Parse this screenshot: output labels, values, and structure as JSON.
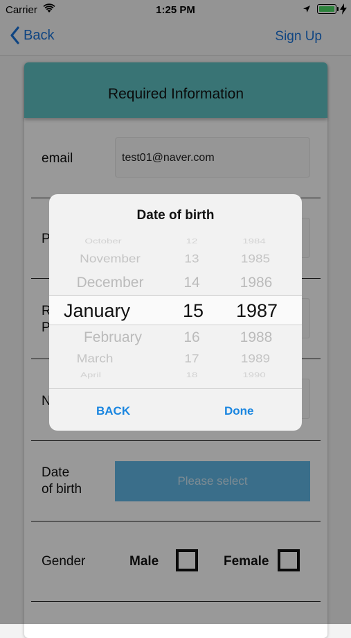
{
  "status": {
    "carrier": "Carrier",
    "time": "1:25 PM"
  },
  "nav": {
    "back_label": "Back",
    "signup_label": "Sign Up"
  },
  "form": {
    "header_title": "Required Information",
    "email_label": "email",
    "email_value": "test01@naver.com",
    "password_label_partial": "P",
    "repeat_label_line1_partial": "R",
    "repeat_label_line2_partial": "P",
    "name_label_partial": "N",
    "dob_label_line1": "Date",
    "dob_label_line2": "of birth",
    "dob_button": "Please select",
    "gender_label": "Gender",
    "male_label": "Male",
    "female_label": "Female"
  },
  "picker": {
    "title": "Date of birth",
    "rows": [
      {
        "month": "October",
        "day": "12",
        "year": "1984"
      },
      {
        "month": "November",
        "day": "13",
        "year": "1985"
      },
      {
        "month": "December",
        "day": "14",
        "year": "1986"
      },
      {
        "month": "January",
        "day": "15",
        "year": "1987"
      },
      {
        "month": "February",
        "day": "16",
        "year": "1988"
      },
      {
        "month": "March",
        "day": "17",
        "year": "1989"
      },
      {
        "month": "April",
        "day": "18",
        "year": "1990"
      }
    ],
    "back_label": "BACK",
    "done_label": "Done"
  },
  "colors": {
    "accent": "#1a73d9",
    "header": "#5fc2c3",
    "select_button": "#62b8e6",
    "dialog_action": "#1a86e0"
  },
  "icons": [
    "wifi-icon",
    "location-icon",
    "battery-icon",
    "charging-icon",
    "back-chevron-icon"
  ]
}
